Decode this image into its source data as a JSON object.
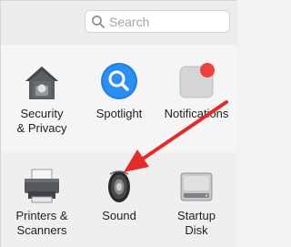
{
  "search": {
    "placeholder": "Search"
  },
  "row1": [
    {
      "label": "Security\n& Privacy",
      "icon": "security-house-icon"
    },
    {
      "label": "Spotlight",
      "icon": "spotlight-magnifier-icon"
    },
    {
      "label": "Notifications",
      "icon": "notifications-icon"
    }
  ],
  "row2": [
    {
      "label": "Printers &\nScanners",
      "icon": "printer-icon"
    },
    {
      "label": "Sound",
      "icon": "speaker-icon"
    },
    {
      "label": "Startup\nDisk",
      "icon": "hard-disk-icon"
    }
  ],
  "colors": {
    "arrow": "#e52a2a",
    "spotlight": "#1f7fe0",
    "notification_dot": "#ef4040"
  }
}
